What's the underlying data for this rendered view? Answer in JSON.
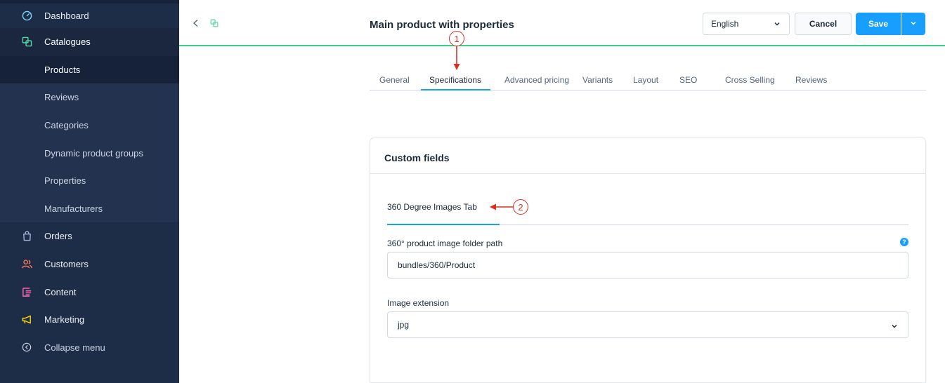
{
  "sidebar": {
    "items": [
      {
        "label": "Dashboard",
        "icon": "dashboard-icon",
        "color": "#9aa9bd"
      },
      {
        "label": "Catalogues",
        "icon": "catalogues-icon",
        "color": "#57d9a3"
      },
      {
        "label": "Orders",
        "icon": "orders-icon",
        "color": "#a3b6d9"
      },
      {
        "label": "Customers",
        "icon": "customers-icon",
        "color": "#ff7a5c"
      },
      {
        "label": "Content",
        "icon": "content-icon",
        "color": "#ff68b4"
      },
      {
        "label": "Marketing",
        "icon": "marketing-icon",
        "color": "#ffd700"
      }
    ],
    "sub_items": [
      "Products",
      "Reviews",
      "Categories",
      "Dynamic product groups",
      "Properties",
      "Manufacturers"
    ],
    "collapse_label": "Collapse menu"
  },
  "header": {
    "title": "Main product with properties",
    "language": "English",
    "cancel_label": "Cancel",
    "save_label": "Save"
  },
  "tabs": [
    "General",
    "Specifications",
    "Advanced pricing",
    "Variants",
    "Layout",
    "SEO",
    "Cross Selling",
    "Reviews"
  ],
  "annotations": {
    "one": "1",
    "two": "2"
  },
  "card": {
    "title": "Custom fields",
    "inner_tab": "360 Degree Images Tab",
    "folder_label": "360° product image folder path",
    "folder_value": "bundles/360/Product",
    "extension_label": "Image extension",
    "extension_value": "jpg"
  },
  "colors": {
    "accent": "#189eff",
    "header_border": "#37d08a",
    "annotation": "#d93025",
    "sidebar_bg": "#1e2d47"
  }
}
